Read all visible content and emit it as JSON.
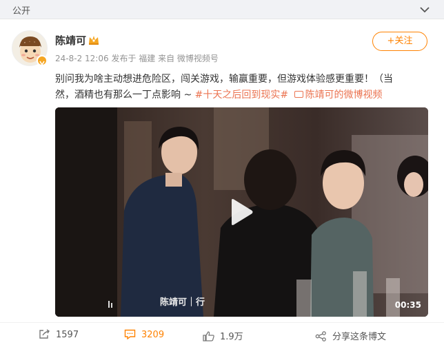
{
  "topbar": {
    "visibility_label": "公开"
  },
  "post": {
    "username": "陈靖可",
    "date": "24-8-2 12:06",
    "location": "发布于 福建",
    "source": "来自 微博视频号",
    "follow_label": "+关注",
    "text_line1": "别问我为啥主动想进危险区，闯关游戏，输赢重要，但游戏体验感更重要！（当",
    "text_line2_prefix": "然，酒精也有那么一丁点影响 ~ ",
    "hashtag": "#十天之后回到现实#",
    "video_link": "陈靖可的微博视频"
  },
  "video": {
    "caption": "陈靖可｜行",
    "duration": "00:35"
  },
  "actions": {
    "share_count": "1597",
    "comment_count": "3209",
    "like_count": "1.9万",
    "share_fans_label": "分享这条博文"
  },
  "colors": {
    "accent": "#ff8200",
    "link": "#eb7350"
  }
}
